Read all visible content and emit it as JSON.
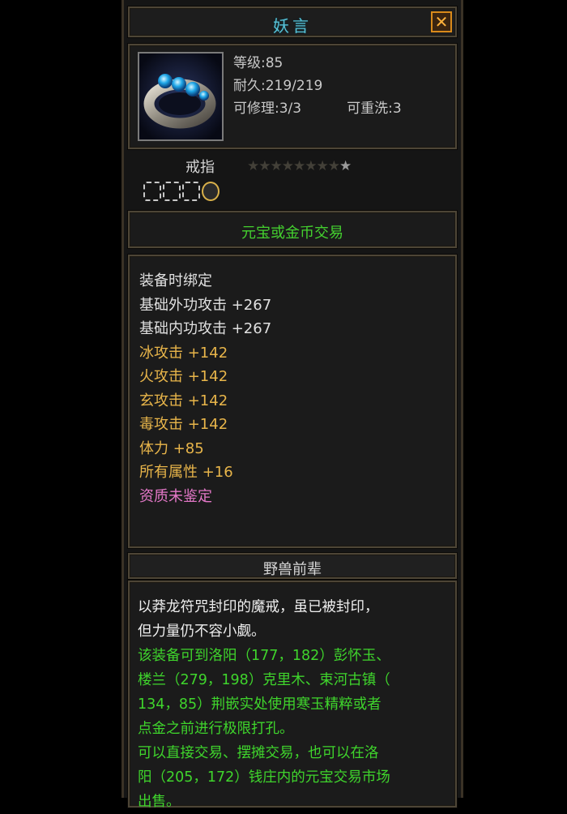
{
  "item": {
    "name": "妖言",
    "close_label": "✕",
    "icon": "ring-icon",
    "level": "等级:85",
    "durability": "耐久:219/219",
    "repairable": "可修理:3/3",
    "rewash": "可重洗:3",
    "type": "戒指",
    "stars": {
      "lit": 1,
      "total": 9
    },
    "sockets": [
      "empty",
      "empty",
      "empty",
      "round"
    ]
  },
  "trade": {
    "label": "元宝或金币交易"
  },
  "attributes": [
    {
      "text": "装备时绑定",
      "color": "white"
    },
    {
      "text": "基础外功攻击 +267",
      "color": "white"
    },
    {
      "text": "基础内功攻击 +267",
      "color": "white"
    },
    {
      "text": "冰攻击 +142",
      "color": "gold"
    },
    {
      "text": "火攻击 +142",
      "color": "gold"
    },
    {
      "text": "玄攻击 +142",
      "color": "gold"
    },
    {
      "text": "毒攻击 +142",
      "color": "gold"
    },
    {
      "text": "体力 +85",
      "color": "gold"
    },
    {
      "text": "所有属性 +16",
      "color": "gold"
    },
    {
      "text": "资质未鉴定",
      "color": "pink"
    }
  ],
  "set": {
    "name": "野兽前辈"
  },
  "description": {
    "lore": [
      "以莽龙符咒封印的魔戒，虽已被封印，",
      "但力量仍不容小觑。"
    ],
    "hint": [
      "该装备可到洛阳（177，182）彭怀玉、",
      "楼兰（279，198）克里木、束河古镇（",
      "134，85）荆嵌实处使用寒玉精粹或者",
      "点金之前进行极限打孔。",
      "可以直接交易、摆摊交易，也可以在洛",
      "阳（205，172）钱庄内的元宝交易市场",
      "出售。"
    ]
  },
  "colors": {
    "title": "#58c3d9",
    "trade_green": "#44d12f",
    "attr_white": "#e0e0e0",
    "attr_gold": "#e8b54a",
    "attr_pink": "#e478c8",
    "desc_green": "#3fd52c"
  }
}
